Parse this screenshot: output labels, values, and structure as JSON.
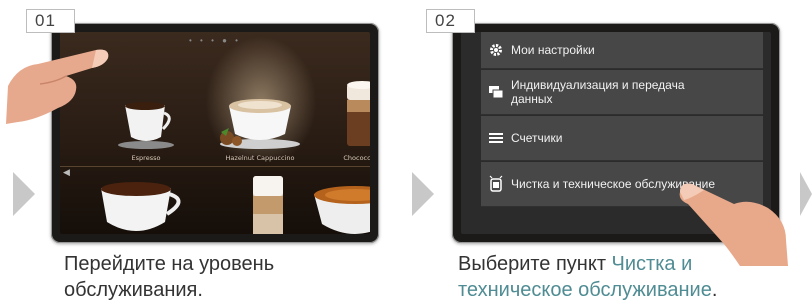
{
  "steps": [
    {
      "number": "01",
      "carousel_indicator": "• • • ● •",
      "products": [
        "Espresso",
        "Hazelnut Cappuccino",
        "Chococcino"
      ],
      "caption": "Перейдите на уровень обслуживания."
    },
    {
      "number": "02",
      "menu_items": [
        {
          "label": "Мои настройки",
          "icon": "gear-icon"
        },
        {
          "label": "Индивидуализация и передача данных",
          "icon": "data-transfer-icon"
        },
        {
          "label": "Счетчики",
          "icon": "menu-lines-icon"
        },
        {
          "label": "Чистка и техническое обслуживание",
          "icon": "maintenance-icon"
        }
      ],
      "caption_prefix": "Выберите пункт ",
      "caption_highlight": "Чистка и техническое обслуживание",
      "caption_suffix": "."
    }
  ],
  "colors": {
    "accent_text": "#4f8c93",
    "arrow": "#c8c8c8",
    "menu_item_bg": "#474747"
  }
}
